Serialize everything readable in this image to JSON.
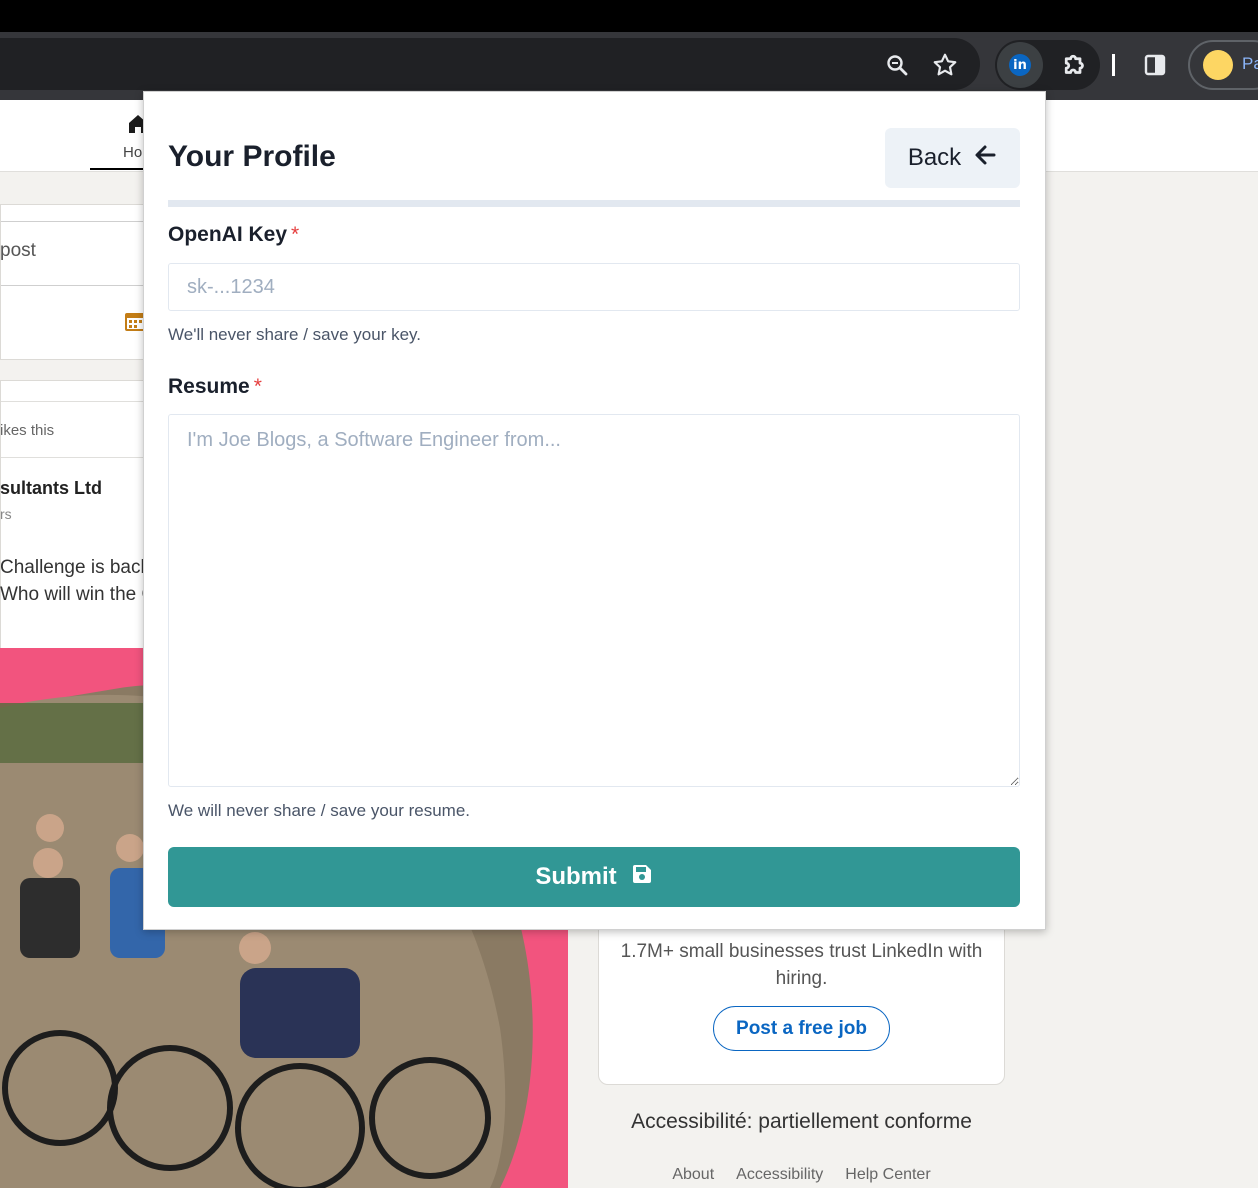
{
  "browser": {
    "profile_label": "Pa",
    "icons": [
      "zoom-icon",
      "star-icon",
      "linkedin-extension-icon",
      "puzzle-icon",
      "side-panel-icon"
    ]
  },
  "background": {
    "nav_home_label": "Ho",
    "post_prompt": "post",
    "likes_text": "ikes this",
    "company_name": "sultants Ltd",
    "company_sub": "rs",
    "post_line1": "Challenge is back,",
    "post_line2": "Who will win the C",
    "trust_text": "1.7M+ small businesses trust LinkedIn with hiring.",
    "post_job_label": "Post a free job",
    "accessibility_text": "Accessibilité: partiellement conforme",
    "footer_links": [
      "About",
      "Accessibility",
      "Help Center"
    ]
  },
  "popup": {
    "title": "Your Profile",
    "back_label": "Back",
    "openai_key": {
      "label": "OpenAI Key",
      "required_mark": "*",
      "placeholder": "sk-...1234",
      "helper": "We'll never share / save your key."
    },
    "resume": {
      "label": "Resume",
      "required_mark": "*",
      "placeholder": "I'm Joe Blogs, a Software Engineer from...",
      "helper": "We will never share / save your resume."
    },
    "submit_label": "Submit"
  },
  "colors": {
    "accent": "#319795",
    "required": "#e53e3e",
    "linkedin_blue": "#0a66c2"
  }
}
